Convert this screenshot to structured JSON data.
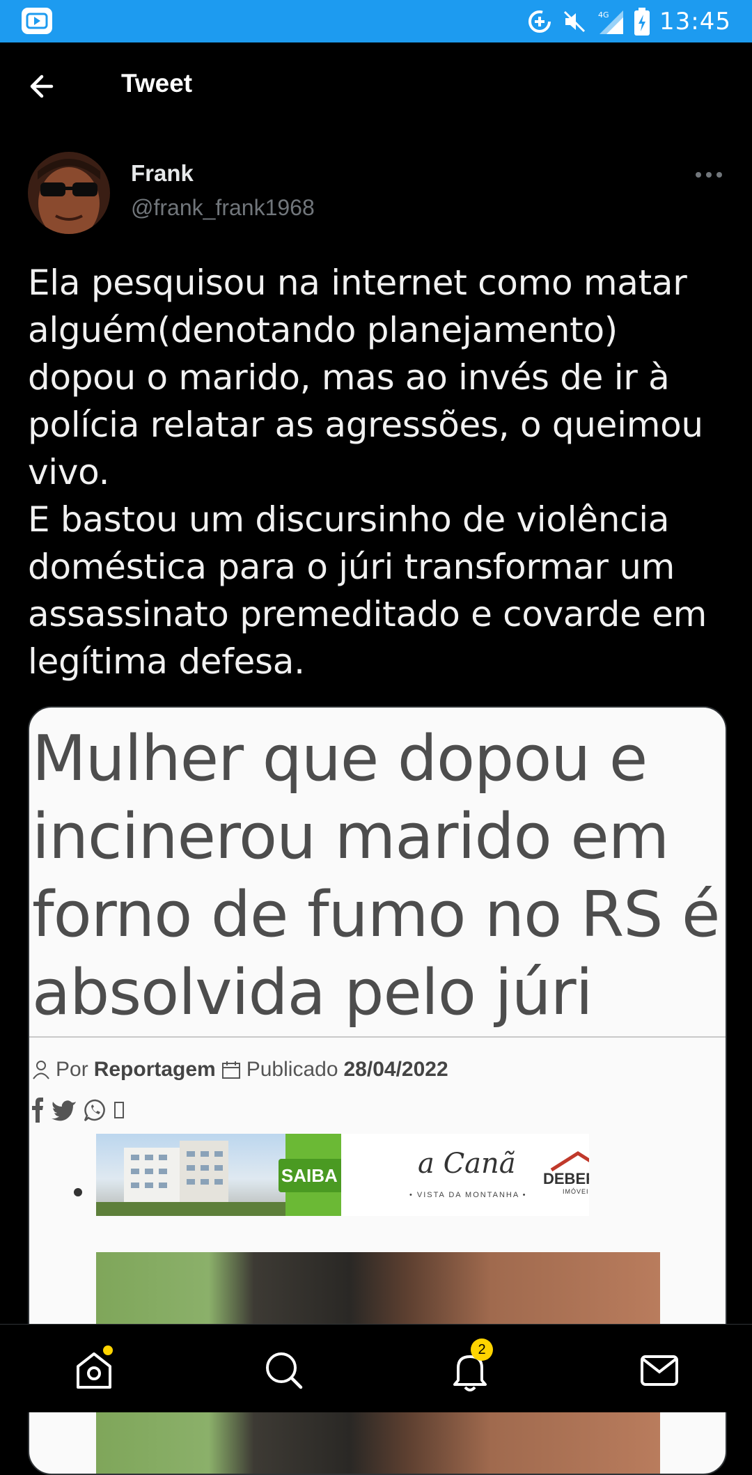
{
  "status_bar": {
    "time": "13:45",
    "network": "4G"
  },
  "header": {
    "title": "Tweet"
  },
  "author": {
    "name": "Frank",
    "handle": "@frank_frank1968"
  },
  "tweet": {
    "text": "Ela pesquisou na internet como matar alguém(denotando planejamento) dopou o marido, mas ao invés de ir à polícia relatar as agressões, o queimou vivo.\nE bastou um discursinho de violência doméstica para o júri transformar um assassinato premeditado e covarde em legítima defesa."
  },
  "media": {
    "headline": "Mulher que dopou e incinerou marido em forno de fumo no RS é absolvida pelo júri",
    "byline_prefix": "Por",
    "byline_author": "Reportagem",
    "published_label": "Publicado",
    "published_date": "28/04/2022",
    "ad": {
      "button": "SAIBA MAIS",
      "logo1": "a Canã",
      "logo1_sub": "• VISTA DA MONTANHA •",
      "logo2": "DEBERG",
      "logo2_sub": "IMÓVEIS"
    }
  },
  "bottom_nav": {
    "notifications_count": "2"
  },
  "colors": {
    "status_bar": "#1d9bf0",
    "background": "#000000",
    "badge": "#ffd400"
  }
}
